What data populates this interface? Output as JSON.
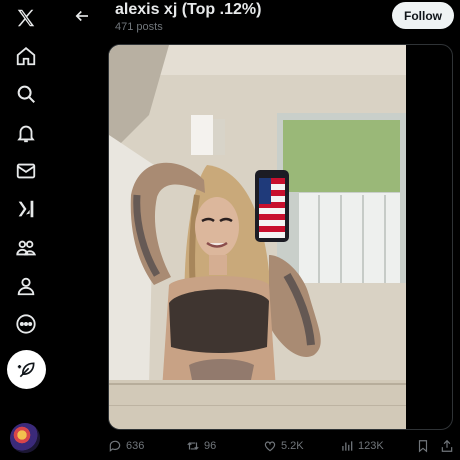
{
  "header": {
    "title": "alexis xj (Top .12%)",
    "post_count": "471 posts",
    "follow_label": "Follow"
  },
  "nav": {
    "items": [
      {
        "icon": "x-logo-icon"
      },
      {
        "icon": "home-icon"
      },
      {
        "icon": "search-icon"
      },
      {
        "icon": "bell-icon"
      },
      {
        "icon": "mail-icon"
      },
      {
        "icon": "grok-icon"
      },
      {
        "icon": "communities-icon"
      },
      {
        "icon": "profile-icon"
      },
      {
        "icon": "more-icon"
      }
    ],
    "compose_icon": "feather-icon"
  },
  "media": {
    "description_icon": "photo"
  },
  "actions": {
    "replies": "636",
    "reposts": "96",
    "likes": "5.2K",
    "views": "123K"
  },
  "colors": {
    "background": "#000000",
    "text": "#e7e9ea",
    "muted": "#71767b",
    "follow_bg": "#eff3f4"
  }
}
